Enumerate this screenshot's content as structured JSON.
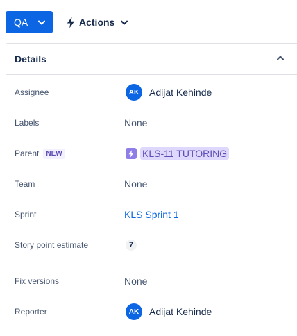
{
  "toolbar": {
    "status_label": "QA",
    "actions_label": "Actions"
  },
  "details": {
    "title": "Details",
    "fields": {
      "assignee": {
        "label": "Assignee",
        "initials": "AK",
        "name": "Adijat Kehinde"
      },
      "labels": {
        "label": "Labels",
        "value": "None"
      },
      "parent": {
        "label": "Parent",
        "badge": "NEW",
        "value": "KLS-11 TUTORING"
      },
      "team": {
        "label": "Team",
        "value": "None"
      },
      "sprint": {
        "label": "Sprint",
        "value": "KLS Sprint 1"
      },
      "story_points": {
        "label": "Story point estimate",
        "value": "7"
      },
      "fix_versions": {
        "label": "Fix versions",
        "value": "None"
      },
      "reporter": {
        "label": "Reporter",
        "initials": "AK",
        "name": "Adijat Kehinde"
      }
    }
  },
  "colors": {
    "accent": "#0c66e4",
    "epic": "#8f7ee7",
    "parent_bg": "#dfd8fd",
    "parent_text": "#5e4db2"
  },
  "icons": {
    "status_chevron": "chevron-down-icon",
    "actions": "lightning-icon",
    "collapse": "chevron-up-icon",
    "epic": "lightning-icon"
  }
}
